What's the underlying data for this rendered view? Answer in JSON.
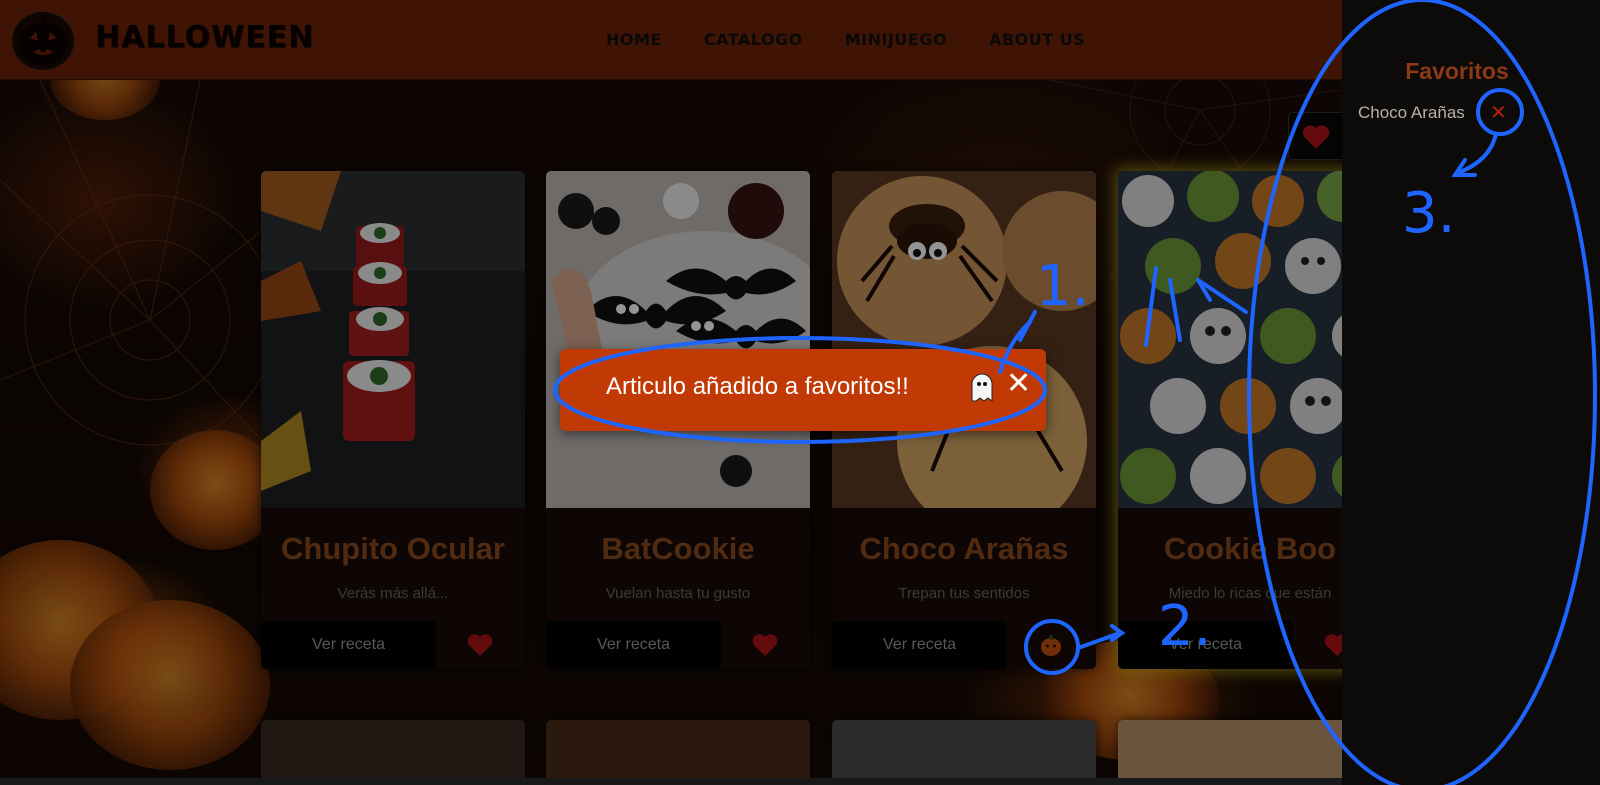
{
  "header": {
    "logo_text": "HALLOWEEN",
    "nav": [
      "HOME",
      "CATALOGO",
      "MINIJUEGO",
      "ABOUT US"
    ]
  },
  "cards": [
    {
      "title": "Chupito Ocular",
      "desc": "Verás más allá...",
      "button": "Ver receta",
      "fav_icon": "heart-icon",
      "favorited": false
    },
    {
      "title": "BatCookie",
      "desc": "Vuelan hasta tu gusto",
      "button": "Ver receta",
      "fav_icon": "heart-icon",
      "favorited": false
    },
    {
      "title": "Choco Arañas",
      "desc": "Trepan tus sentidos",
      "button": "Ver receta",
      "fav_icon": "pumpkin-icon",
      "favorited": true
    },
    {
      "title": "Cookie Boo",
      "desc": "Miedo lo ricas que están",
      "button": "Ver receta",
      "fav_icon": "heart-icon",
      "favorited": false
    }
  ],
  "toast": {
    "message": "Articulo añadido a favoritos!!",
    "icon": "ghost-icon",
    "close": "✕"
  },
  "sidebar": {
    "title": "Favoritos",
    "items": [
      {
        "label": "Choco Arañas",
        "remove": "✕"
      }
    ]
  },
  "annotations": [
    "1.",
    "2.",
    "3."
  ],
  "colors": {
    "header_bg": "#6e2308",
    "accent_orange": "#c13a06",
    "title_brown": "#8a4a1e",
    "annotation_blue": "#1e64ff"
  }
}
